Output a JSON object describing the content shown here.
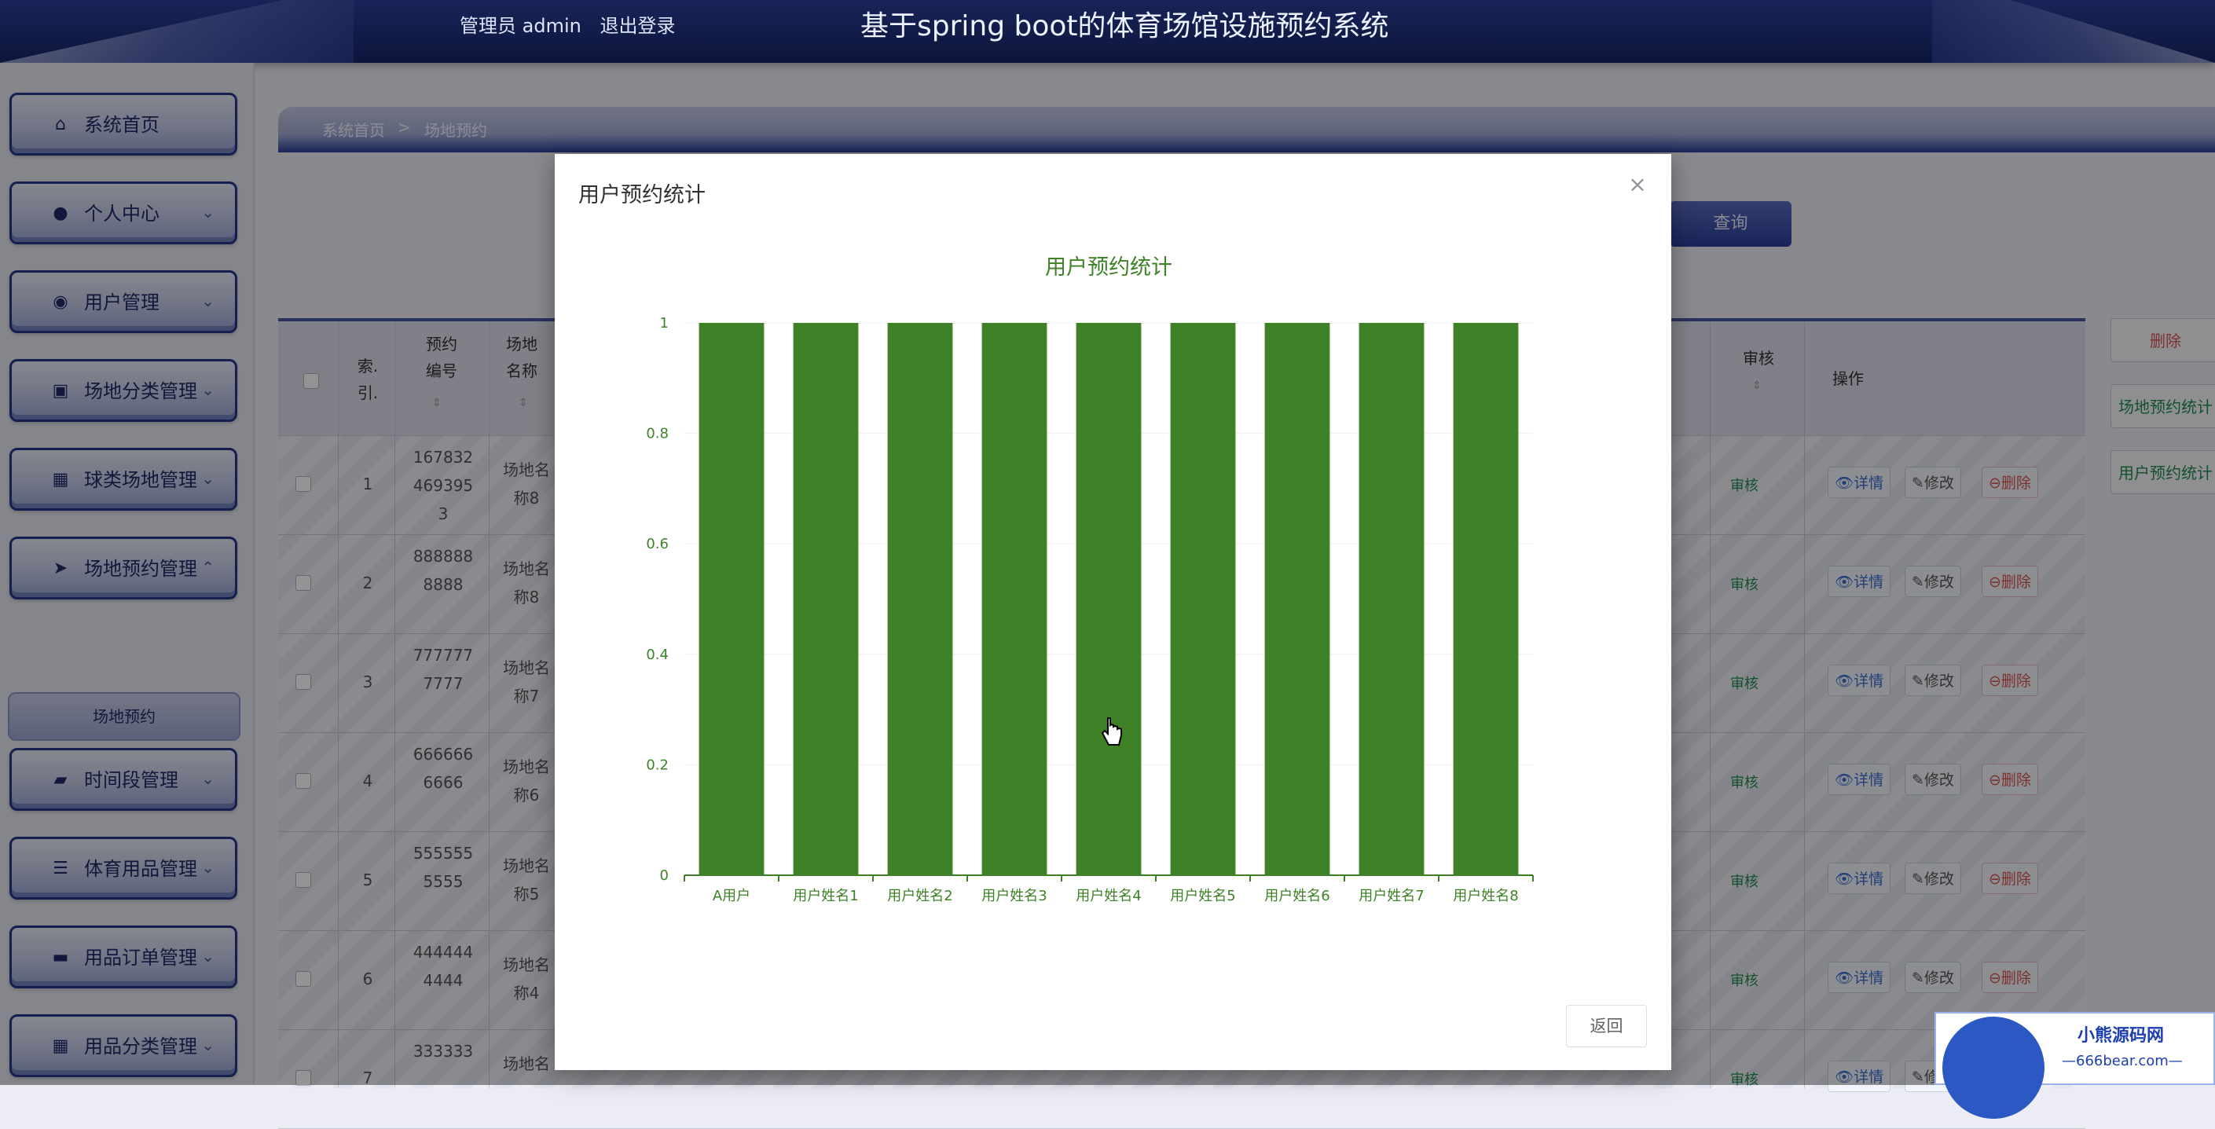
{
  "header": {
    "user_label": "管理员 admin",
    "logout_label": "退出登录",
    "title": "基于spring boot的体育场馆设施预约系统"
  },
  "sidebar": {
    "items": [
      {
        "label": "系统首页",
        "icon": "home-icon"
      },
      {
        "label": "个人中心",
        "icon": "user-icon"
      },
      {
        "label": "用户管理",
        "icon": "users-icon"
      },
      {
        "label": "场地分类管理",
        "icon": "category-icon"
      },
      {
        "label": "球类场地管理",
        "icon": "grid-icon"
      },
      {
        "label": "场地预约管理",
        "icon": "send-icon"
      },
      {
        "label": "时间段管理",
        "icon": "briefcase-icon"
      },
      {
        "label": "体育用品管理",
        "icon": "list-icon"
      },
      {
        "label": "用品订单管理",
        "icon": "order-icon"
      },
      {
        "label": "用品分类管理",
        "icon": "grid-icon"
      }
    ],
    "subitem": "场地预约"
  },
  "breadcrumb": {
    "home": "系统首页",
    "sep": ">",
    "current": "场地预约"
  },
  "toolbar": {
    "query": "查询",
    "delete": "删除",
    "venue_stats": "场地预约统计",
    "user_stats": "用户预约统计"
  },
  "table": {
    "headers": {
      "index": [
        "索.",
        "引."
      ],
      "booking_no": [
        "预约",
        "编号"
      ],
      "venue_name": [
        "场地",
        "名称"
      ],
      "review": "审核",
      "ops": "操作"
    },
    "rows": [
      {
        "index": "1",
        "no": [
          "167832",
          "469395",
          "3"
        ],
        "venue": [
          "场地名",
          "称8"
        ],
        "review": "审核"
      },
      {
        "index": "2",
        "no": [
          "888888",
          "8888"
        ],
        "venue": [
          "场地名",
          "称8"
        ],
        "review": "审核"
      },
      {
        "index": "3",
        "no": [
          "777777",
          "7777"
        ],
        "venue": [
          "场地名",
          "称7"
        ],
        "review": "审核"
      },
      {
        "index": "4",
        "no": [
          "666666",
          "6666"
        ],
        "venue": [
          "场地名",
          "称6"
        ],
        "review": "审核"
      },
      {
        "index": "5",
        "no": [
          "555555",
          "5555"
        ],
        "venue": [
          "场地名",
          "称5"
        ],
        "review": "审核"
      },
      {
        "index": "6",
        "no": [
          "444444",
          "4444"
        ],
        "venue": [
          "场地名",
          "称4"
        ],
        "review": "审核"
      },
      {
        "index": "7",
        "no": [
          "333333"
        ],
        "venue": [
          "场地名"
        ],
        "review": "审核"
      }
    ],
    "ops": {
      "detail": "详情",
      "edit": "修改",
      "delete": "删除"
    }
  },
  "modal": {
    "title": "用户预约统计",
    "close": "×",
    "return": "返回"
  },
  "chart_data": {
    "type": "bar",
    "title": "用户预约统计",
    "categories": [
      "A用户",
      "用户姓名1",
      "用户姓名2",
      "用户姓名3",
      "用户姓名4",
      "用户姓名5",
      "用户姓名6",
      "用户姓名7",
      "用户姓名8"
    ],
    "values": [
      1,
      1,
      1,
      1,
      1,
      1,
      1,
      1,
      1
    ],
    "ylim": [
      0,
      1
    ],
    "yticks": [
      "0",
      "0.2",
      "0.4",
      "0.6",
      "0.8",
      "1"
    ],
    "grid": true,
    "bar_color": "#3e8127",
    "label_color": "#3e8127"
  },
  "watermark": {
    "line1": "小熊源码网",
    "line2": "—666bear.com—"
  }
}
